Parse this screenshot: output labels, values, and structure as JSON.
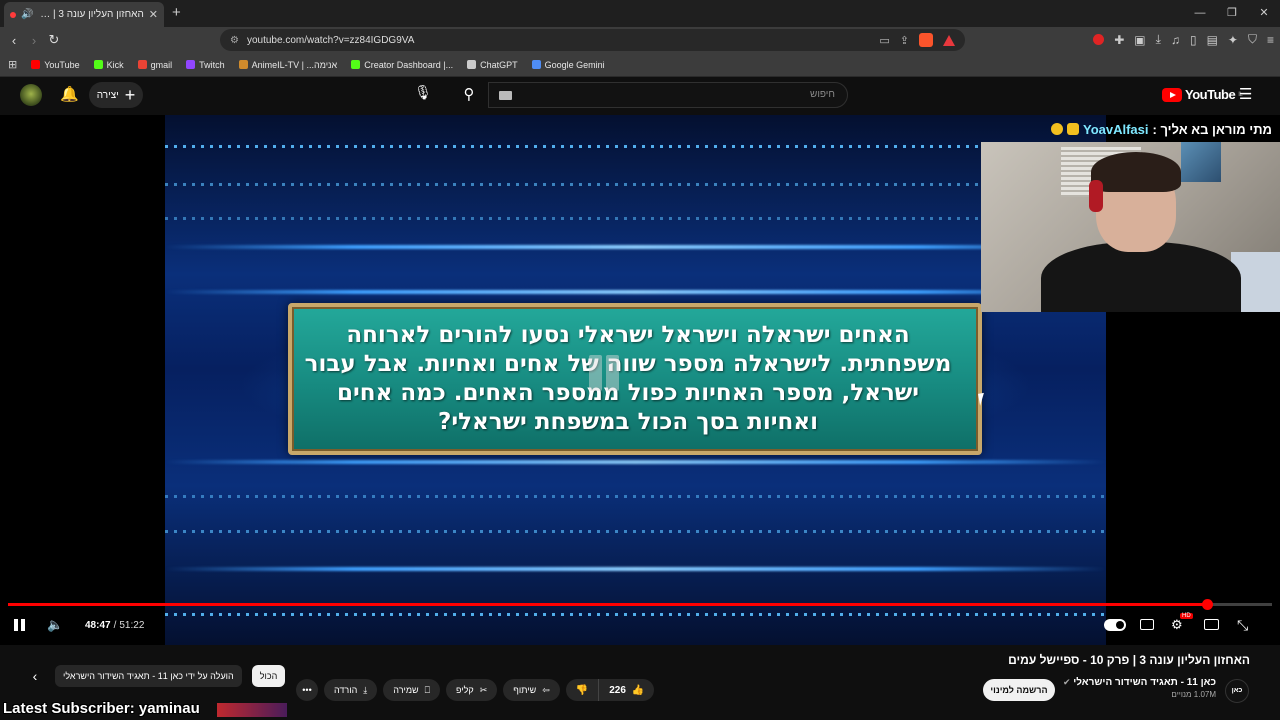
{
  "browser": {
    "tab_title": "האחזון העליון עונה 3 | פרק 10",
    "url": "youtube.com/watch?v=zz84IGDG9VA",
    "bookmarks": [
      {
        "label": "YouTube",
        "color": "#ff0000"
      },
      {
        "label": "Kick",
        "color": "#53fc18"
      },
      {
        "label": "gmail",
        "color": "#ea4335"
      },
      {
        "label": "Twitch",
        "color": "#9146ff"
      },
      {
        "label": "AnimeIL-TV | ...אנימה",
        "color": "#d08b2c"
      },
      {
        "label": "Creator Dashboard |...",
        "color": "#53fc18"
      },
      {
        "label": "ChatGPT",
        "color": "#cccccc"
      },
      {
        "label": "Google Gemini",
        "color": "#4f8df5"
      }
    ]
  },
  "header": {
    "create_label": "יצירה",
    "search_placeholder": "חיפוש",
    "logo_text": "YouTube",
    "logo_region": "IL"
  },
  "video": {
    "question_text": "האחים ישראלה וישראל ישראלי נסעו להורים לארוחה משפחתית. לישראלה מספר שווה של אחים ואחיות. אבל עבור ישראל, מספר האחיות כפול ממספר האחים. כמה אחים ואחיות בסך הכול במשפחת ישראלי?",
    "chat_user": "YoavAlfasi",
    "chat_message": "מתי מוראן בא אליך :",
    "current_time": "48:47",
    "duration": "51:22",
    "progress_fraction": 0.9489
  },
  "details": {
    "title": "האחזון העליון עונה 3 | פרק 10 - ספיישל עמים",
    "channel_avatar_text": "כאן",
    "channel_name": "כאן 11 - תאגיד השידור הישראלי",
    "subscribers": "1.07M מנויים",
    "subscribe_label": "הרשמה למינוי",
    "like_count": "226",
    "share_label": "שיתוף",
    "clip_label": "קליפ",
    "save_label": "שמירה",
    "download_label": "הורדה",
    "chip_all": "הכול",
    "chip_uploaded_by": "הועלה על ידי כאן 11 - תאגיד השידור הישראלי",
    "overlay_text": "Latest Subscriber: yaminau"
  }
}
